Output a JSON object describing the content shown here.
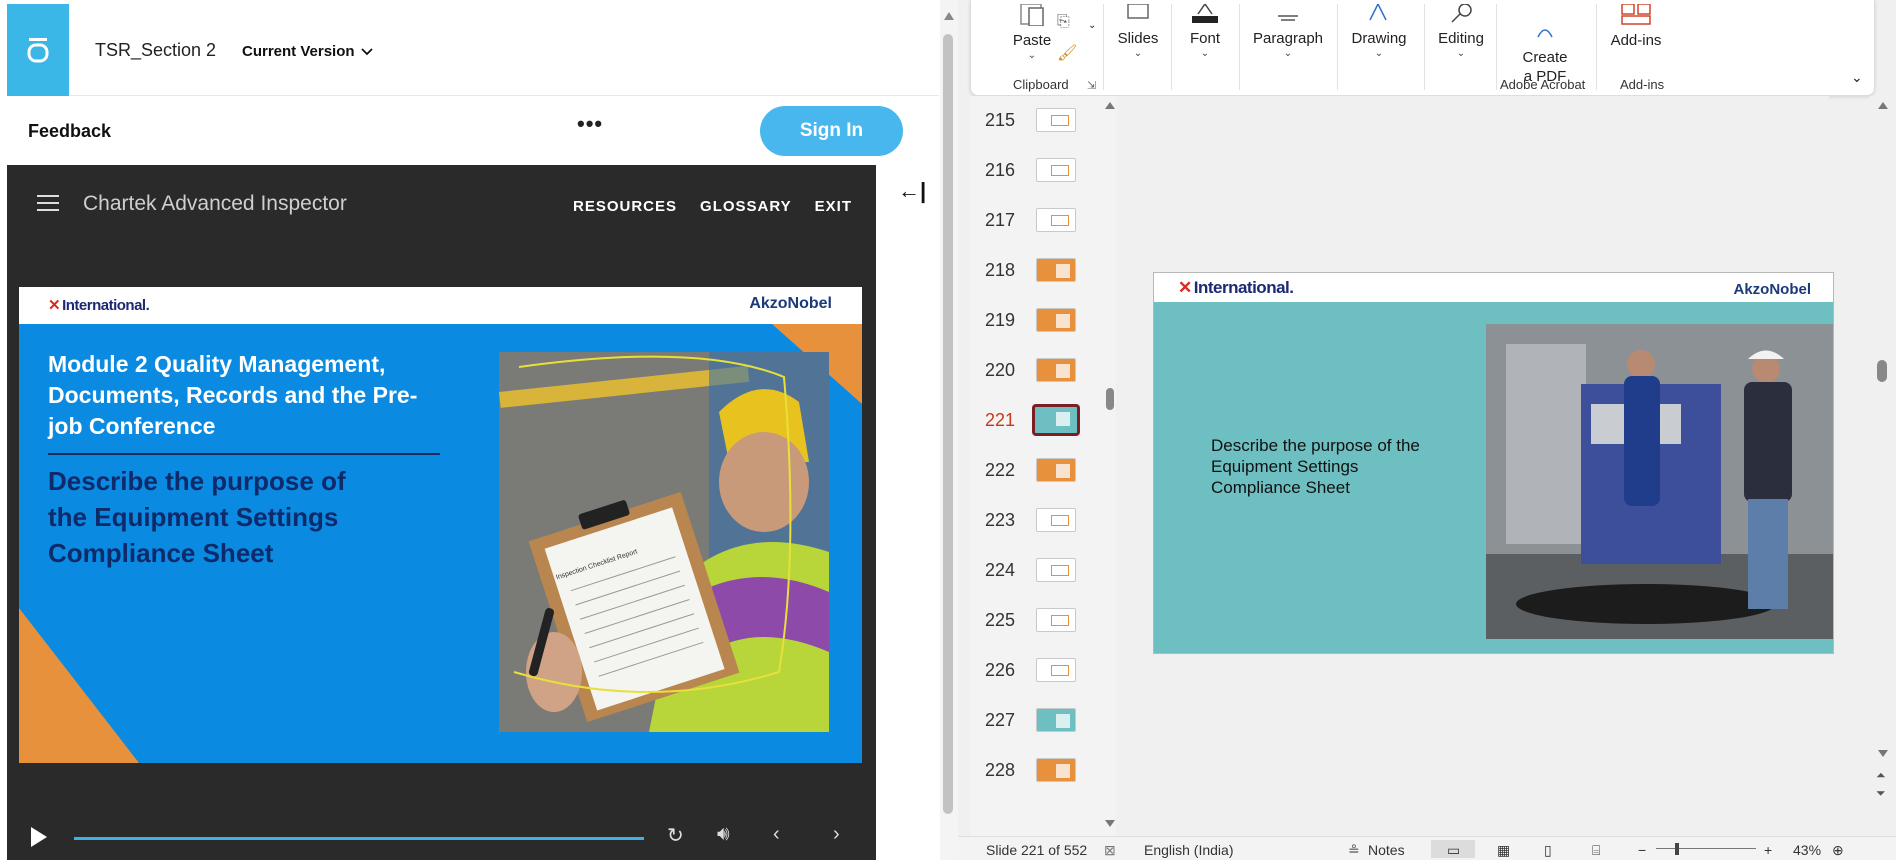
{
  "left": {
    "doc_title": "TSR_Section 2",
    "version_label": "Current Version",
    "feedback_label": "Feedback",
    "more_label": "•••",
    "signin_label": "Sign In",
    "course_title": "Chartek Advanced Inspector",
    "nav_links": [
      "RESOURCES",
      "GLOSSARY",
      "EXIT"
    ],
    "slide": {
      "logo_left": "International.",
      "logo_right": "AkzoNobel",
      "heading": "Module 2 Quality Management, Documents, Records and the Pre-job Conference",
      "subheading": "Describe the purpose of the Equipment Settings Compliance Sheet",
      "clipboard_text": "Inspection Checklist Report"
    },
    "collapse_icon": "←|"
  },
  "ribbon": {
    "buttons": [
      {
        "label": "Paste"
      },
      {
        "label": "Slides"
      },
      {
        "label": "Font"
      },
      {
        "label": "Paragraph"
      },
      {
        "label": "Drawing"
      },
      {
        "label": "Editing"
      },
      {
        "label": "Create\na PDF"
      },
      {
        "label": "Add-ins"
      }
    ],
    "groups": [
      "Clipboard",
      "Adobe Acrobat",
      "Add-ins"
    ]
  },
  "thumbnails": [
    {
      "num": "215",
      "kind": "white"
    },
    {
      "num": "216",
      "kind": "white"
    },
    {
      "num": "217",
      "kind": "white"
    },
    {
      "num": "218",
      "kind": "orange"
    },
    {
      "num": "219",
      "kind": "orange"
    },
    {
      "num": "220",
      "kind": "orange"
    },
    {
      "num": "221",
      "kind": "teal",
      "selected": true
    },
    {
      "num": "222",
      "kind": "orange"
    },
    {
      "num": "223",
      "kind": "white"
    },
    {
      "num": "224",
      "kind": "white"
    },
    {
      "num": "225",
      "kind": "white"
    },
    {
      "num": "226",
      "kind": "white"
    },
    {
      "num": "227",
      "kind": "teal"
    },
    {
      "num": "228",
      "kind": "orange"
    }
  ],
  "main_slide": {
    "logo_left": "International.",
    "logo_right": "AkzoNobel",
    "text": "Describe the purpose of the Equipment Settings Compliance Sheet"
  },
  "status": {
    "slide_info": "Slide 221 of 552",
    "language": "English (India)",
    "notes": "Notes",
    "zoom": "43%"
  },
  "colors": {
    "accent_blue": "#3ab7e6",
    "slide_blue": "#0a8ae0",
    "slide_teal": "#6dbfc2",
    "orange": "#e8913c",
    "selected_thumb": "#7a1f24"
  }
}
